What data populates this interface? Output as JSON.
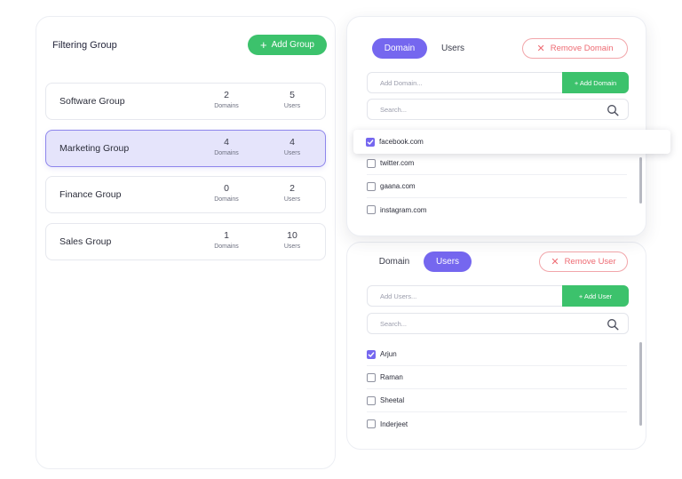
{
  "filtering": {
    "title": "Filtering Group",
    "add_button": "Add Group",
    "groups": [
      {
        "name": "Software Group",
        "domains": "2",
        "users": "5",
        "domains_label": "Domains",
        "users_label": "Users",
        "selected": false
      },
      {
        "name": "Marketing Group",
        "domains": "4",
        "users": "4",
        "domains_label": "Domains",
        "users_label": "Users",
        "selected": true
      },
      {
        "name": "Finance Group",
        "domains": "0",
        "users": "2",
        "domains_label": "Domains",
        "users_label": "Users",
        "selected": false
      },
      {
        "name": "Sales Group",
        "domains": "1",
        "users": "10",
        "domains_label": "Domains",
        "users_label": "Users",
        "selected": false
      }
    ]
  },
  "domain_panel": {
    "tab_domain": "Domain",
    "tab_users": "Users",
    "remove_button": "Remove Domain",
    "add_placeholder": "Add Domain...",
    "add_button": "+ Add Domain",
    "search_placeholder": "Search...",
    "items": [
      {
        "label": "facebook.com",
        "checked": true
      },
      {
        "label": "twitter.com",
        "checked": false
      },
      {
        "label": "gaana.com",
        "checked": false
      },
      {
        "label": "instagram.com",
        "checked": false
      }
    ]
  },
  "user_panel": {
    "tab_domain": "Domain",
    "tab_users": "Users",
    "remove_button": "Remove User",
    "add_placeholder": "Add Users...",
    "add_button": "+ Add User",
    "search_placeholder": "Search...",
    "items": [
      {
        "label": "Arjun",
        "checked": true
      },
      {
        "label": "Raman",
        "checked": false
      },
      {
        "label": "Sheetal",
        "checked": false
      },
      {
        "label": "Inderjeet",
        "checked": false
      }
    ]
  },
  "colors": {
    "accent": "#7567ef",
    "green": "#3cc26c",
    "danger": "#ee6b73",
    "selected_bg": "#e5e4fb"
  }
}
